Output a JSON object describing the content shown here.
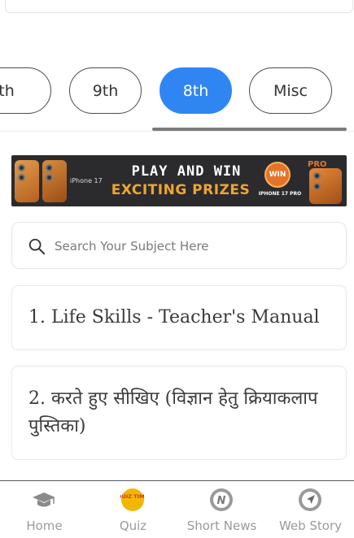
{
  "class_tabs": {
    "items": [
      {
        "label": "th"
      },
      {
        "label": "9th"
      },
      {
        "label": "8th"
      },
      {
        "label": "Misc"
      }
    ],
    "active_index": 2
  },
  "banner": {
    "line1": "PLAY AND WIN",
    "line2": "EXCITING PRIZES",
    "brand": "iPhone 17",
    "win_badge": "WIN",
    "win_sub": "IPHONE 17 PRO",
    "pro_label": "PRO"
  },
  "search": {
    "placeholder": "Search Your Subject Here",
    "value": ""
  },
  "subjects": [
    {
      "title": "1. Life Skills - Teacher's Manual"
    },
    {
      "title": "2. करते हुए सीखिए (विज्ञान हेतु क्रियाकलाप पुस्तिका)"
    }
  ],
  "bottom_nav": {
    "items": [
      {
        "label": "Home",
        "icon": "graduation-cap-icon"
      },
      {
        "label": "Quiz",
        "icon": "quiz-time-icon",
        "badge": "QUIZ TIME"
      },
      {
        "label": "Short News",
        "icon": "news-icon",
        "badge": "N"
      },
      {
        "label": "Web Story",
        "icon": "web-story-icon"
      }
    ]
  },
  "colors": {
    "accent": "#2f86f3",
    "nav_label": "#9a9a9a",
    "card_border": "#e8e8e8",
    "quiz_badge": "#f2b705"
  }
}
